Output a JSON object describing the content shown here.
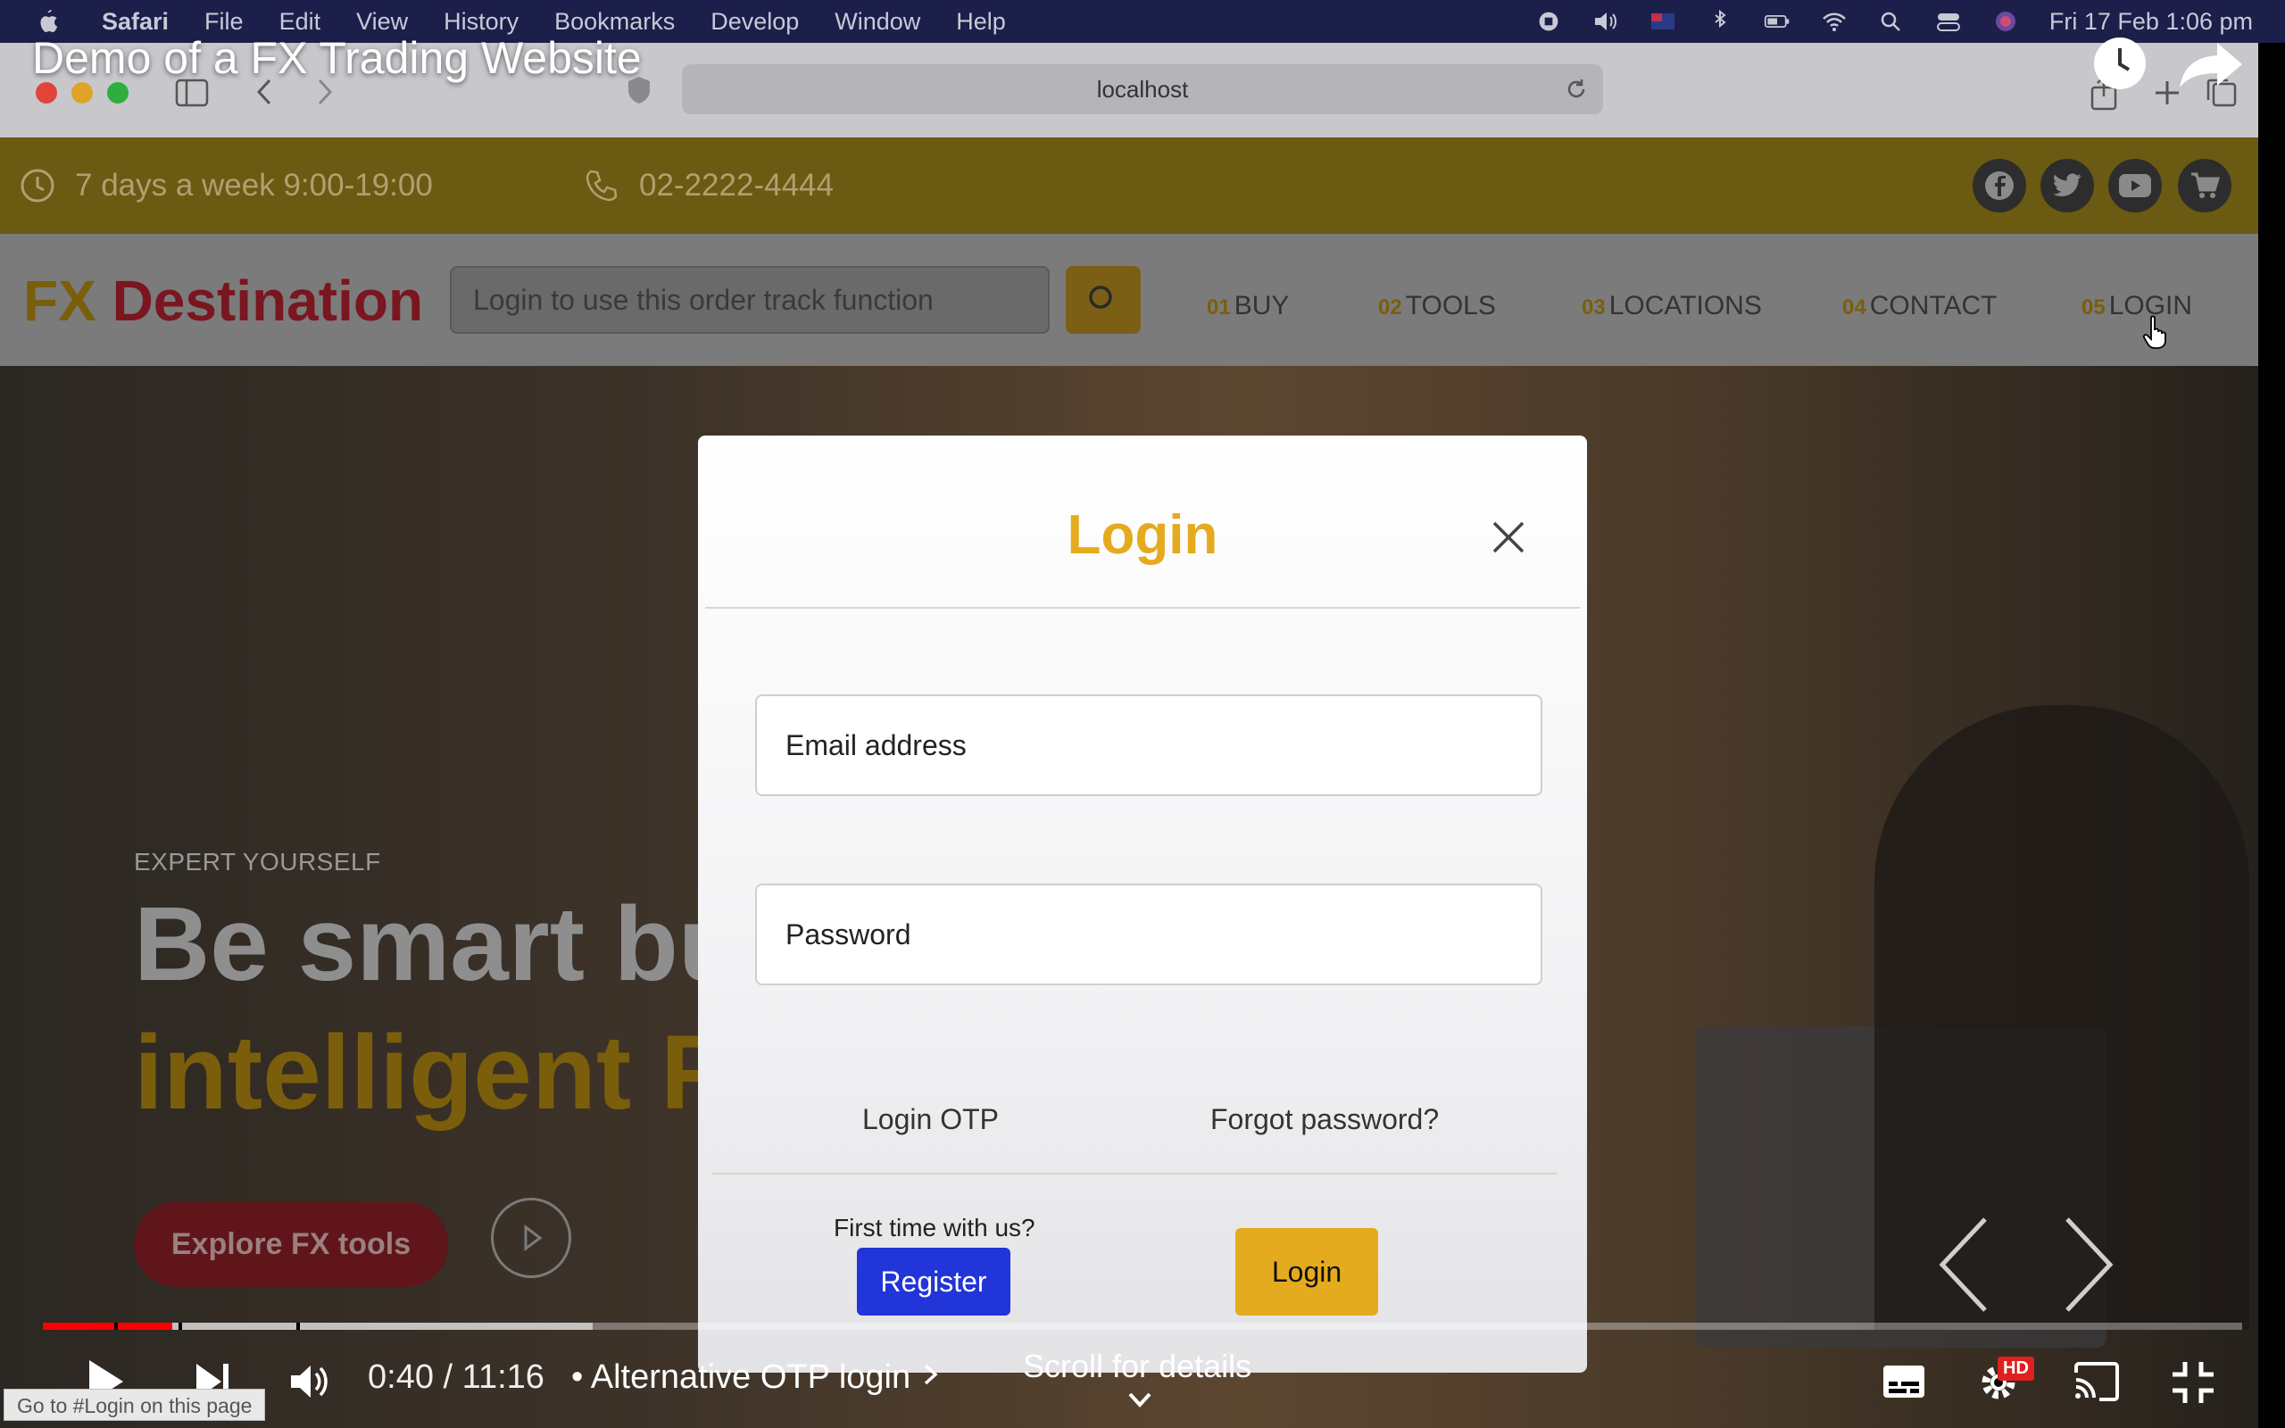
{
  "menubar": {
    "app": "Safari",
    "items": [
      "File",
      "Edit",
      "View",
      "History",
      "Bookmarks",
      "Develop",
      "Window",
      "Help"
    ],
    "clock": "Fri 17 Feb  1:06 pm"
  },
  "browser": {
    "url": "localhost"
  },
  "video": {
    "title": "Demo of a FX Trading Website",
    "time": "0:40 / 11:16",
    "chapter": "• Alternative OTP login",
    "scroll_hint": "Scroll for details",
    "progress_fraction": 0.059,
    "buffer_fraction": 0.25,
    "hd_badge": "HD",
    "status_tooltip": "Go to #Login on this page"
  },
  "site": {
    "hours": "7 days a week 9:00-19:00",
    "phone": "02-2222-4444",
    "brand_prefix": "FX",
    "brand_rest": " Destination",
    "order_track_placeholder": "Login to use this order track function",
    "nav": [
      {
        "num": "01",
        "label": "BUY"
      },
      {
        "num": "02",
        "label": "TOOLS"
      },
      {
        "num": "03",
        "label": "LOCATIONS"
      },
      {
        "num": "04",
        "label": "CONTACT"
      },
      {
        "num": "05",
        "label": "LOGIN"
      }
    ],
    "hero": {
      "kicker": "EXPERT YOURSELF",
      "line1": "Be smart bu",
      "line2": "intelligent FX",
      "cta": "Explore FX tools"
    }
  },
  "modal": {
    "title": "Login",
    "email_placeholder": "Email address",
    "password_placeholder": "Password",
    "otp_link": "Login OTP",
    "forgot_link": "Forgot password?",
    "first_time": "First time with us?",
    "register": "Register",
    "login": "Login"
  },
  "colors": {
    "accent": "#e5ab1f",
    "register_blue": "#2135d8",
    "progress_red": "#ff0000",
    "brand_red": "#c8202f"
  }
}
